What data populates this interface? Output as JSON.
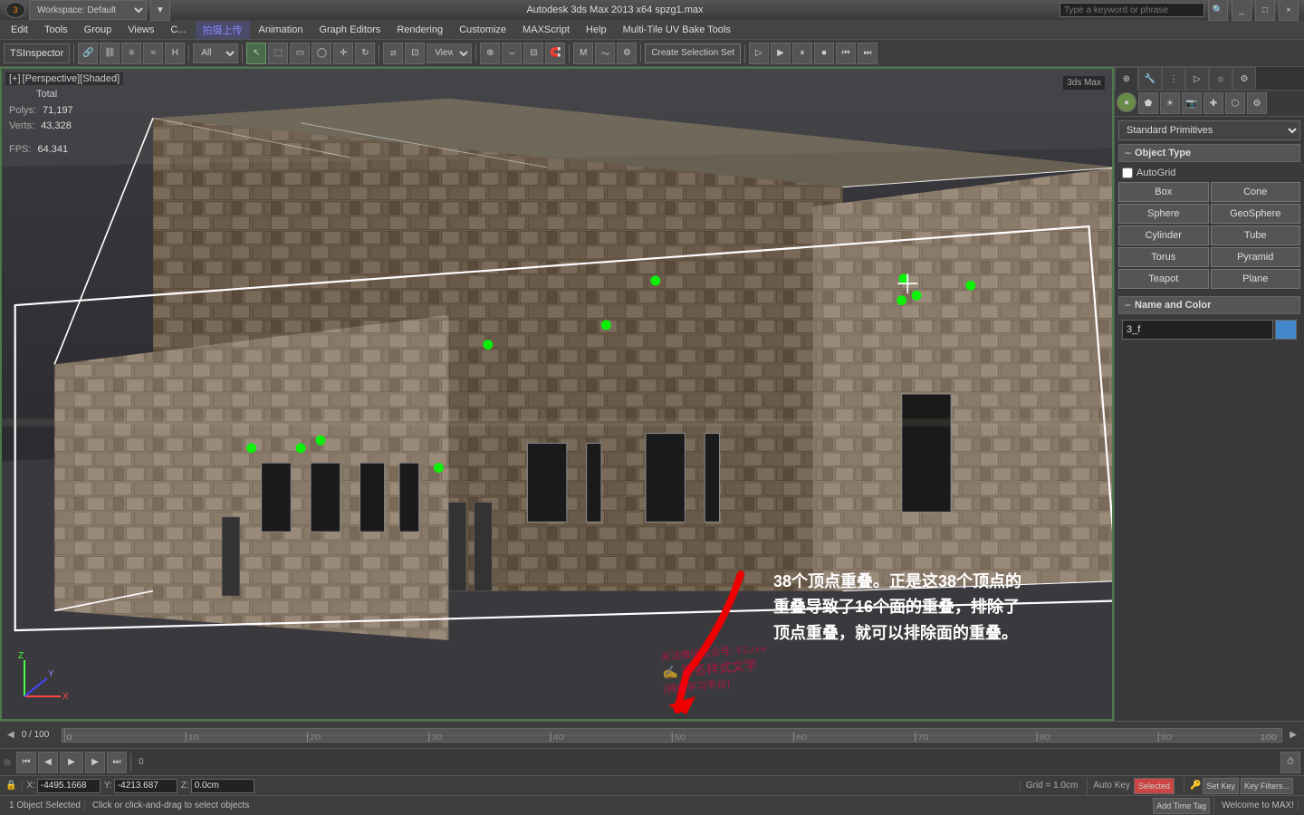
{
  "titlebar": {
    "workspace": "Workspace: Default",
    "title": "Autodesk 3ds Max 2013 x64    spzg1.max",
    "search_placeholder": "Type a keyword or phrase"
  },
  "menubar": {
    "items": [
      {
        "label": "Edit"
      },
      {
        "label": "Tools"
      },
      {
        "label": "Group"
      },
      {
        "label": "Views"
      },
      {
        "label": "C..."
      },
      {
        "label": "拍摄上传"
      },
      {
        "label": "Animation"
      },
      {
        "label": "Graph Editors"
      },
      {
        "label": "Rendering"
      },
      {
        "label": "Customize"
      },
      {
        "label": "MAXScript"
      },
      {
        "label": "Help"
      },
      {
        "label": "Multi-Tile UV Bake Tools"
      }
    ]
  },
  "toolbar": {
    "ts_inspector": "TSInspector",
    "view_mode": "View",
    "create_selection": "Create Selection Set",
    "view_dropdown": "View"
  },
  "viewport": {
    "label_plus": "[+]",
    "label_perspective": "[Perspective]",
    "label_shaded": "[Shaded]",
    "stats": {
      "total_label": "Total",
      "polys_label": "Polys:",
      "polys_value": "71,197",
      "verts_label": "Verts:",
      "verts_value": "43,328",
      "fps_label": "FPS:",
      "fps_value": "64.341"
    }
  },
  "annotation": {
    "line1": "38个顶点重叠。正是这38个顶点的",
    "line2": "重叠导致了16个面的重叠，排除了",
    "line3": "顶点重叠，就可以排除面的重叠。"
  },
  "right_panel": {
    "section_primitives": "Standard Primitives",
    "section_object_type": "Object Type",
    "autogrid_label": "AutoGrid",
    "buttons": [
      {
        "label": "Box"
      },
      {
        "label": "Cone"
      },
      {
        "label": "Sphere"
      },
      {
        "label": "GeoSphere"
      },
      {
        "label": "Cylinder"
      },
      {
        "label": "Tube"
      },
      {
        "label": "Torus"
      },
      {
        "label": "Pyramid"
      },
      {
        "label": "Teapot"
      },
      {
        "label": "Plane"
      }
    ],
    "section_name_color": "Name and Color",
    "name_value": "3_f"
  },
  "timeline": {
    "start": "0",
    "end": "100",
    "current": "0 / 100",
    "ticks": [
      "0",
      "10",
      "20",
      "30",
      "40",
      "50",
      "60",
      "70",
      "80",
      "90",
      "100"
    ]
  },
  "status_bar": {
    "object_selected": "1 Object Selected",
    "instruction": "Click or click-and-drag to select objects",
    "welcome": "Welcome to MAX!",
    "grid": "Grid = 1.0cm",
    "auto_key": "Auto Key",
    "selected": "Selected",
    "set_key": "Set Key",
    "key_filters": "Key Filters...",
    "add_time_tag": "Add Time Tag"
  },
  "coord_bar": {
    "x_label": "X:",
    "x_value": "-4495.1668",
    "y_label": "Y:",
    "y_value": "-4213.687",
    "z_label": "Z:",
    "z_value": "0.0cm"
  },
  "icons": {
    "undo": "↩",
    "redo": "↪",
    "new": "□",
    "open": "📂",
    "save": "💾",
    "play": "▶",
    "pause": "⏸",
    "stop": "⏹",
    "prev": "⏮",
    "next": "⏭",
    "first": "⏮",
    "last": "⏭"
  }
}
